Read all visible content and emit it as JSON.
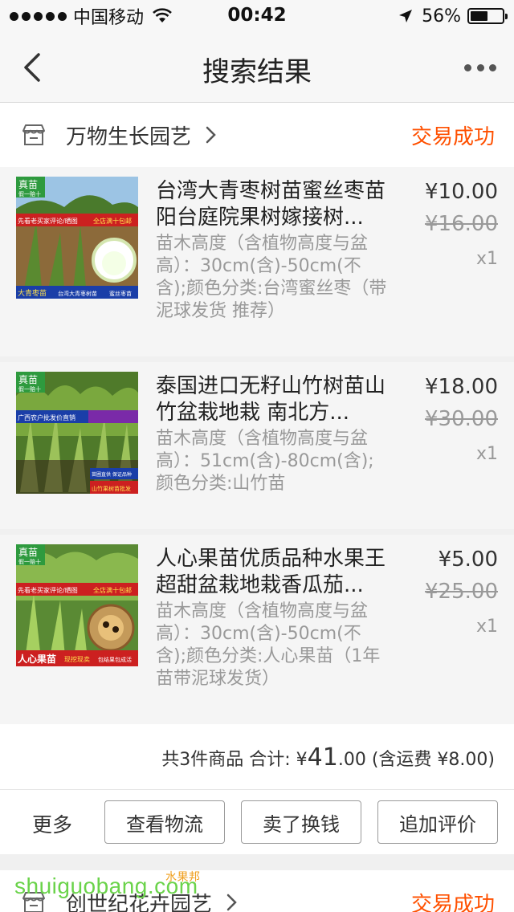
{
  "status_bar": {
    "carrier": "中国移动",
    "time": "00:42",
    "battery": "56%",
    "battery_level": 0.56
  },
  "nav": {
    "title": "搜索结果"
  },
  "orders": [
    {
      "shop": "万物生长园艺",
      "status": "交易成功",
      "items": [
        {
          "title": "台湾大青枣树苗蜜丝枣苗阳台庭院果树嫁接树...",
          "spec": "苗木高度（含植物高度与盆高）：30cm(含)-50cm(不含);颜色分类:台湾蜜丝枣（带泥球发货 推荐）",
          "price": "¥10.00",
          "orig_price": "¥16.00",
          "qty": "x1",
          "img": {
            "badge": "真苗",
            "badge_sub": "假一赔十",
            "banner_left": "先看老买家评论/晒图",
            "banner_right": "全店满十包邮",
            "footer": [
              "大青枣苗",
              "台湾大青枣树苗",
              "蜜丝枣苗"
            ]
          }
        },
        {
          "title": "泰国进口无籽山竹树苗山竹盆栽地栽 南北方...",
          "spec": "苗木高度（含植物高度与盆高）：51cm(含)-80cm(含);颜色分类:山竹苗",
          "price": "¥18.00",
          "orig_price": "¥30.00",
          "qty": "x1",
          "img": {
            "badge": "真苗",
            "badge_sub": "假一赔十",
            "banner_left": "广西农户批发价直销",
            "banner_right": "",
            "footer": [
              "苗圃直供 保证品种",
              "山竹果树苗批发"
            ]
          }
        },
        {
          "title": "人心果苗优质品种水果王超甜盆栽地栽香瓜茄...",
          "spec": "苗木高度（含植物高度与盆高）：30cm(含)-50cm(不含);颜色分类:人心果苗（1年苗带泥球发货）",
          "price": "¥5.00",
          "orig_price": "¥25.00",
          "qty": "x1",
          "img": {
            "badge": "真苗",
            "badge_sub": "假一赔十",
            "banner_left": "先看老买家评论/晒图",
            "banner_right": "全店满十包邮",
            "footer": [
              "人心果苗",
              "现挖现卖",
              "包结果包成活"
            ]
          }
        }
      ],
      "summary": {
        "prefix": "共3件商品 合计: ¥",
        "total_int": "41",
        "total_dec": ".00",
        "suffix": " (含运费 ¥8.00)"
      },
      "actions": {
        "more": "更多",
        "buttons": [
          "查看物流",
          "卖了换钱",
          "追加评价"
        ]
      }
    },
    {
      "shop": "创世纪花卉园艺",
      "status": "交易成功"
    }
  ],
  "watermark": {
    "text": "shuiguobang.com",
    "small": "水果邦"
  },
  "colors": {
    "accent": "#ff5000",
    "text": "#333333",
    "muted": "#999999",
    "watermark": "#6ad34a"
  }
}
